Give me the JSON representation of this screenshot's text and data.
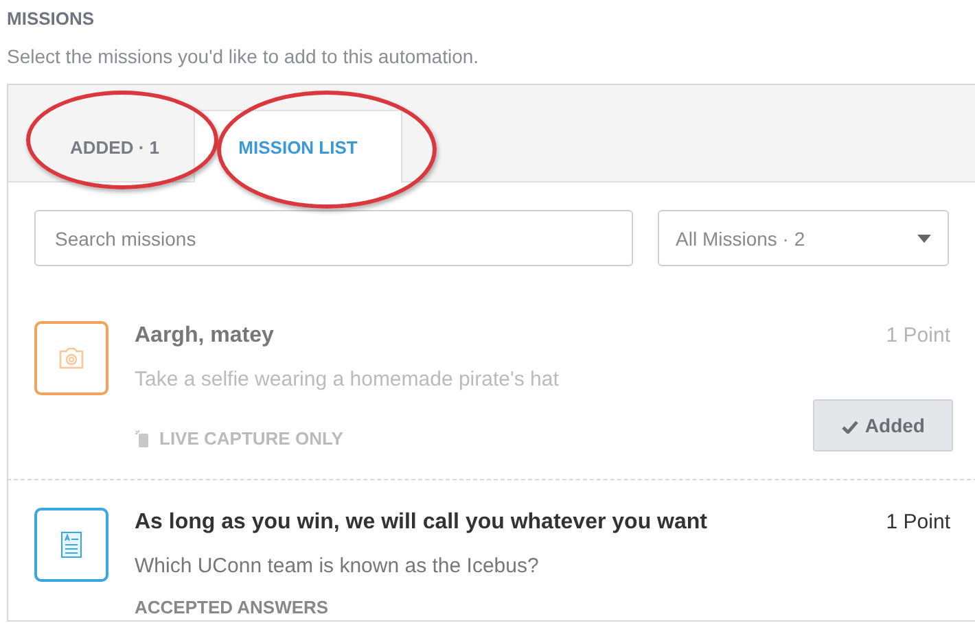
{
  "section": {
    "title": "MISSIONS",
    "subtitle": "Select the missions you'd like to add to this automation."
  },
  "tabs": [
    {
      "label": "ADDED · 1",
      "selected": false
    },
    {
      "label": "MISSION LIST",
      "selected": true
    }
  ],
  "search": {
    "placeholder": "Search missions"
  },
  "filter": {
    "value": "All Missions · 2"
  },
  "missions": [
    {
      "kind": "photo",
      "color": "#f0a35a",
      "added": true,
      "title": "Aargh, matey",
      "points": "1 Point",
      "description": "Take a selfie wearing a homemade pirate's hat",
      "note": "LIVE CAPTURE ONLY",
      "button": "Added"
    },
    {
      "kind": "quiz",
      "color": "#3aa7e0",
      "added": false,
      "title": "As long as you win, we will call you whatever you want",
      "points": "1 Point",
      "description": "Which UConn team is known as the Icebus?",
      "note": "ACCEPTED ANSWERS"
    }
  ]
}
